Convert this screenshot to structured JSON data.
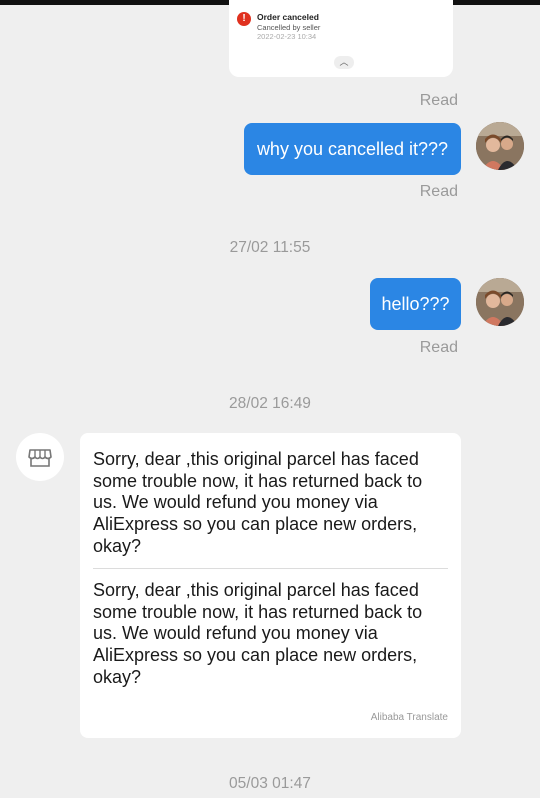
{
  "order_card": {
    "title": "Order canceled",
    "subtitle": "Cancelled by seller",
    "timestamp": "2022-02-23 10:34",
    "alert_symbol": "!",
    "expand_symbol": "︿",
    "alert_color": "#e0311f"
  },
  "messages": [
    {
      "kind": "status",
      "text": "Read"
    },
    {
      "kind": "outgoing",
      "text": "why you cancelled it???",
      "status": "Read"
    },
    {
      "kind": "time",
      "text": "27/02 11:55"
    },
    {
      "kind": "outgoing",
      "text": "hello???",
      "status": "Read"
    },
    {
      "kind": "time",
      "text": "28/02 16:49"
    },
    {
      "kind": "incoming",
      "original": "Sorry, dear ,this original parcel has faced some trouble now, it has returned back to us. We would refund you money via AliExpress so you can place new orders, okay?",
      "translated": "Sorry, dear ,this original parcel has faced some trouble now, it has returned back to us. We would refund you money via AliExpress so you can place new orders, okay?",
      "translate_label": "Alibaba Translate"
    },
    {
      "kind": "time",
      "text": "05/03 01:47"
    }
  ],
  "colors": {
    "outgoing_bubble": "#2b86e4",
    "background": "#efefef"
  },
  "icons": {
    "user_avatar": "user-avatar-photo",
    "shop_avatar": "store-icon"
  }
}
